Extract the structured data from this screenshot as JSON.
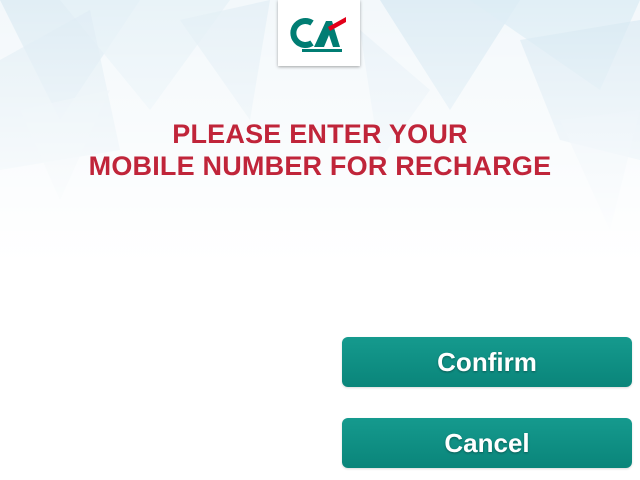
{
  "brand": {
    "logo_text": "CA",
    "logo_icon": "credit-agricole-logo"
  },
  "prompt": {
    "line1": "PLEASE ENTER YOUR",
    "line2": "MOBILE NUMBER FOR RECHARGE"
  },
  "actions": {
    "confirm_label": "Confirm",
    "cancel_label": "Cancel"
  },
  "colors": {
    "prompt_red": "#c0253a",
    "button_teal": "#0e8e83",
    "logo_green": "#007d73",
    "logo_red": "#e2001a"
  }
}
